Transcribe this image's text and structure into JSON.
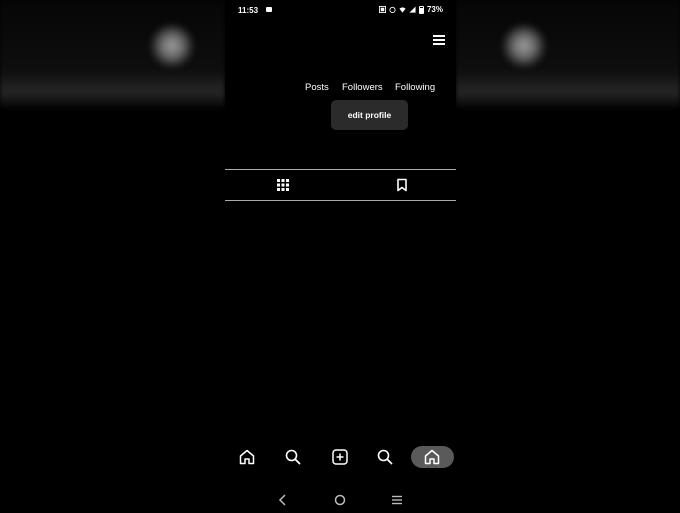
{
  "status_bar": {
    "time": "11:53",
    "battery": "73%"
  },
  "profile": {
    "stats": {
      "posts_label": "Posts",
      "followers_label": "Followers",
      "following_label": "Following"
    },
    "edit_profile_label": "edit profile"
  },
  "icons": {
    "menu": "hamburger-menu-icon",
    "grid_tab": "grid-icon",
    "saved_tab": "bookmark-icon",
    "nav": [
      "home-icon",
      "search-icon",
      "add-icon",
      "search-icon",
      "home-icon"
    ],
    "android": [
      "back-icon",
      "home-circle-icon",
      "recents-icon"
    ]
  },
  "colors": {
    "background": "#000000",
    "button_bg": "#2b2b2b",
    "active_nav_bg": "#5a5a5a",
    "text": "#ffffff"
  }
}
